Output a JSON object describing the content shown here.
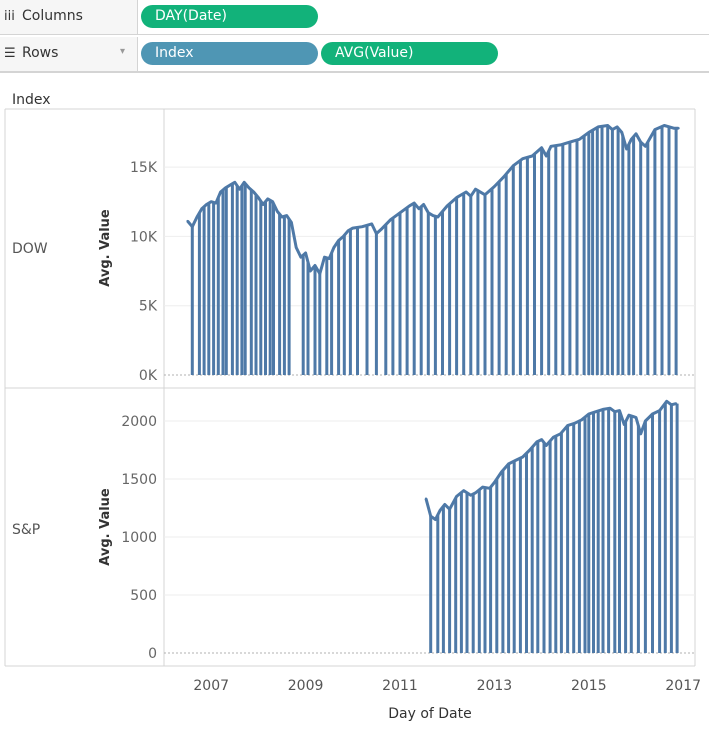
{
  "shelves": {
    "columns": {
      "label": "Columns",
      "icon": "iii",
      "pills": [
        "DAY(Date)"
      ]
    },
    "rows": {
      "label": "Rows",
      "icon": "☰",
      "caret": "▾",
      "pills": [
        "Index",
        "AVG(Value)"
      ]
    }
  },
  "colors": {
    "line": "#4e79a7",
    "dimension_pill": "#4f96b4",
    "measure_pill": "#12b27a"
  },
  "chart_data": {
    "type": "line",
    "row_header_title": "Index",
    "xlabel": "Day of Date",
    "x_ticks": [
      "2007",
      "2009",
      "2011",
      "2013",
      "2015",
      "2017"
    ],
    "x_range": [
      "2006-01",
      "2017-03"
    ],
    "grid": true,
    "panes": [
      {
        "name": "DOW",
        "ylabel": "Avg. Value",
        "y_ticks": [
          "0K",
          "5K",
          "10K",
          "15K"
        ],
        "y_tick_values": [
          0,
          5000,
          10000,
          15000
        ],
        "ylim": [
          0,
          18900
        ],
        "x": [
          2006.5,
          2006.6,
          2006.7,
          2006.8,
          2006.9,
          2007.0,
          2007.1,
          2007.2,
          2007.3,
          2007.4,
          2007.5,
          2007.6,
          2007.7,
          2007.8,
          2007.9,
          2008.0,
          2008.1,
          2008.2,
          2008.3,
          2008.4,
          2008.5,
          2008.6,
          2008.7,
          2008.8,
          2008.9,
          2009.0,
          2009.1,
          2009.2,
          2009.3,
          2009.4,
          2009.5,
          2009.6,
          2009.7,
          2009.8,
          2009.9,
          2010.0,
          2010.2,
          2010.4,
          2010.5,
          2010.6,
          2010.8,
          2011.0,
          2011.2,
          2011.3,
          2011.4,
          2011.5,
          2011.6,
          2011.7,
          2011.8,
          2012.0,
          2012.2,
          2012.4,
          2012.5,
          2012.6,
          2012.8,
          2013.0,
          2013.2,
          2013.4,
          2013.6,
          2013.8,
          2014.0,
          2014.1,
          2014.2,
          2014.4,
          2014.6,
          2014.8,
          2015.0,
          2015.2,
          2015.4,
          2015.5,
          2015.6,
          2015.7,
          2015.8,
          2015.9,
          2016.0,
          2016.1,
          2016.2,
          2016.4,
          2016.6,
          2016.8,
          2016.9
        ],
        "values": [
          11100,
          10700,
          11400,
          12000,
          12300,
          12500,
          12400,
          13200,
          13500,
          13700,
          13900,
          13400,
          13900,
          13500,
          13200,
          12800,
          12300,
          12700,
          12500,
          11800,
          11400,
          11500,
          11000,
          9200,
          8500,
          8800,
          7500,
          7900,
          7300,
          8500,
          8400,
          9200,
          9700,
          10000,
          10400,
          10600,
          10700,
          10900,
          10200,
          10500,
          11200,
          11700,
          12200,
          12400,
          12000,
          12300,
          11700,
          11500,
          11400,
          12200,
          12800,
          13200,
          12900,
          13400,
          13000,
          13600,
          14300,
          15100,
          15600,
          15800,
          16400,
          15800,
          16500,
          16600,
          16800,
          17000,
          17500,
          17900,
          18000,
          17700,
          17900,
          17500,
          16300,
          17000,
          17400,
          16800,
          16500,
          17700,
          18000,
          17800,
          17800
        ],
        "drop_dates": [
          2006.6,
          2006.75,
          2006.85,
          2006.95,
          2007.05,
          2007.15,
          2007.25,
          2007.32,
          2007.45,
          2007.55,
          2007.65,
          2007.72,
          2007.85,
          2007.95,
          2008.05,
          2008.15,
          2008.25,
          2008.32,
          2008.45,
          2008.55,
          2008.65,
          2008.95,
          2009.05,
          2009.2,
          2009.3,
          2009.45,
          2009.55,
          2009.7,
          2009.82,
          2009.95,
          2010.1,
          2010.3,
          2010.5,
          2010.7,
          2010.85,
          2011.0,
          2011.15,
          2011.3,
          2011.45,
          2011.6,
          2011.75,
          2011.9,
          2012.05,
          2012.2,
          2012.35,
          2012.5,
          2012.65,
          2012.8,
          2012.95,
          2013.1,
          2013.25,
          2013.4,
          2013.55,
          2013.7,
          2013.85,
          2014.0,
          2014.15,
          2014.3,
          2014.45,
          2014.6,
          2014.75,
          2014.9,
          2015.0,
          2015.08,
          2015.18,
          2015.28,
          2015.4,
          2015.5,
          2015.62,
          2015.72,
          2015.85,
          2015.95,
          2016.1,
          2016.25,
          2016.4,
          2016.55,
          2016.7,
          2016.85
        ]
      },
      {
        "name": "S&P",
        "ylabel": "Avg. Value",
        "y_ticks": [
          "0",
          "500",
          "1000",
          "1500",
          "2000"
        ],
        "y_tick_values": [
          0,
          500,
          1000,
          1500,
          2000
        ],
        "ylim": [
          0,
          2250
        ],
        "x": [
          2011.55,
          2011.65,
          2011.75,
          2011.85,
          2011.95,
          2012.05,
          2012.2,
          2012.35,
          2012.5,
          2012.6,
          2012.75,
          2012.9,
          2013.0,
          2013.15,
          2013.3,
          2013.45,
          2013.6,
          2013.75,
          2013.9,
          2014.0,
          2014.1,
          2014.25,
          2014.4,
          2014.55,
          2014.7,
          2014.85,
          2015.0,
          2015.15,
          2015.3,
          2015.45,
          2015.55,
          2015.65,
          2015.75,
          2015.85,
          2016.0,
          2016.1,
          2016.2,
          2016.35,
          2016.5,
          2016.65,
          2016.75,
          2016.85
        ],
        "values": [
          1330,
          1180,
          1150,
          1230,
          1280,
          1240,
          1350,
          1400,
          1360,
          1380,
          1430,
          1420,
          1470,
          1560,
          1630,
          1660,
          1690,
          1750,
          1820,
          1840,
          1790,
          1860,
          1890,
          1960,
          1980,
          2010,
          2060,
          2080,
          2100,
          2110,
          2080,
          2090,
          1970,
          2050,
          2030,
          1890,
          2000,
          2060,
          2090,
          2170,
          2140,
          2150
        ],
        "drop_dates": [
          2011.65,
          2011.8,
          2011.92,
          2012.05,
          2012.18,
          2012.3,
          2012.42,
          2012.55,
          2012.68,
          2012.8,
          2012.92,
          2013.05,
          2013.18,
          2013.3,
          2013.42,
          2013.55,
          2013.68,
          2013.8,
          2013.92,
          2014.05,
          2014.18,
          2014.3,
          2014.42,
          2014.55,
          2014.68,
          2014.8,
          2014.92,
          2015.0,
          2015.1,
          2015.2,
          2015.3,
          2015.42,
          2015.55,
          2015.65,
          2015.78,
          2015.9,
          2016.05,
          2016.2,
          2016.35,
          2016.5,
          2016.62,
          2016.75,
          2016.87
        ]
      }
    ]
  }
}
